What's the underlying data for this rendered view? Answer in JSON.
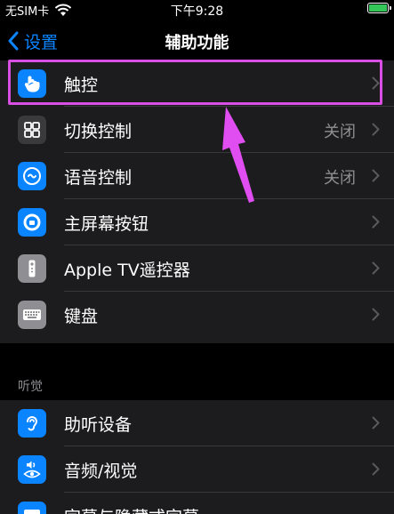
{
  "status": {
    "carrier": "无SIM卡",
    "time": "下午9:28"
  },
  "nav": {
    "back_label": "设置",
    "title": "辅助功能"
  },
  "group1": [
    {
      "label": "触控",
      "value": "",
      "icon": "touch-hand-icon"
    },
    {
      "label": "切换控制",
      "value": "关闭",
      "icon": "switch-grid-icon"
    },
    {
      "label": "语音控制",
      "value": "关闭",
      "icon": "voice-control-icon"
    },
    {
      "label": "主屏幕按钮",
      "value": "",
      "icon": "home-button-icon"
    },
    {
      "label": "Apple TV遥控器",
      "value": "",
      "icon": "remote-icon"
    },
    {
      "label": "键盘",
      "value": "",
      "icon": "keyboard-icon"
    }
  ],
  "section_header": "听觉",
  "group2": [
    {
      "label": "助听设备",
      "value": "",
      "icon": "ear-icon"
    },
    {
      "label": "音频/视觉",
      "value": "",
      "icon": "audio-visual-icon"
    },
    {
      "label": "字幕与隐藏式字幕",
      "value": "",
      "icon": "subtitles-icon"
    }
  ],
  "colors": {
    "accent": "#0a84ff",
    "highlight": "#d94fe4",
    "battery": "#35c659"
  }
}
